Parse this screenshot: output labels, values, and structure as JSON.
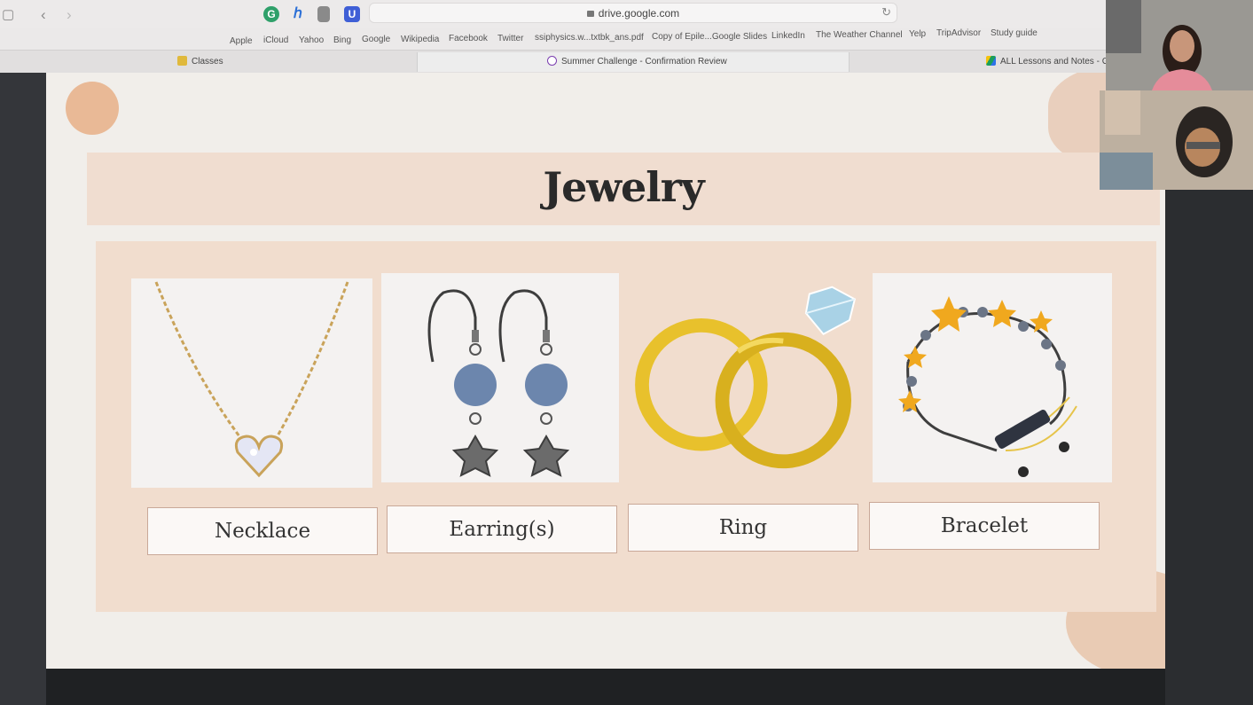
{
  "browser": {
    "url": "drive.google.com",
    "bookmarks": [
      "Apple",
      "iCloud",
      "Yahoo",
      "Bing",
      "Google",
      "Wikipedia",
      "Facebook",
      "Twitter",
      "ssiphysics.w...txtbk_ans.pdf",
      "Copy of Epile...Google Slides",
      "LinkedIn",
      "The Weather Channel",
      "Yelp",
      "TripAdvisor",
      "Study guide"
    ],
    "tabs": [
      "Classes",
      "Summer Challenge - Confirmation Review",
      "ALL Lessons and Notes - G"
    ]
  },
  "slide": {
    "title": "Jewelry",
    "items": [
      {
        "label": "Necklace",
        "icon": "necklace-icon"
      },
      {
        "label": "Earring(s)",
        "icon": "earrings-icon"
      },
      {
        "label": "Ring",
        "icon": "rings-icon"
      },
      {
        "label": "Bracelet",
        "icon": "bracelet-icon"
      }
    ]
  },
  "colors": {
    "title_band": "#f0ddd0",
    "panel": "#f1ddce",
    "label_border": "#c9a898",
    "gold": "#e8c12c"
  }
}
